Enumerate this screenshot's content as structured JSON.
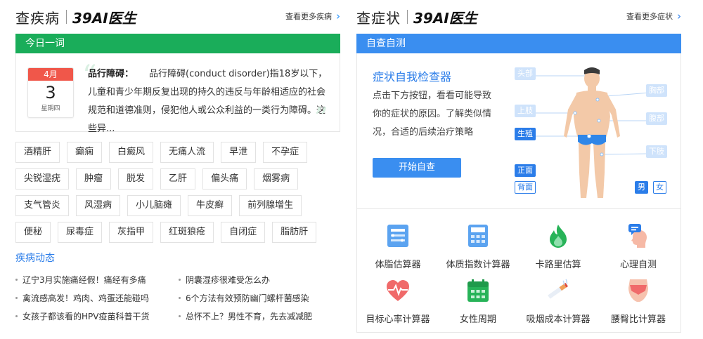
{
  "left": {
    "title": "查疾病",
    "brand": "39AI医生",
    "more": "查看更多疾病",
    "bar": "今日一词",
    "calendar": {
      "month": "4月",
      "day": "3",
      "weekday": "星期四"
    },
    "word": {
      "term": "品行障碍：",
      "text": "品行障碍(conduct disorder)指18岁以下，儿童和青少年期反复出现的持久的违反与年龄相适应的社会规范和道德准则，侵犯他人或公众利益的一类行为障碍。这些异..."
    },
    "tags": [
      [
        "酒精肝",
        "癫痫",
        "白癜风",
        "无痛人流",
        "早泄",
        "不孕症"
      ],
      [
        "尖锐湿疣",
        "肿瘤",
        "脱发",
        "乙肝",
        "偏头痛",
        "烟雾病"
      ],
      [
        "支气管炎",
        "风湿病",
        "小儿脑瘫",
        "牛皮癣",
        "前列腺增生"
      ],
      [
        "便秘",
        "尿毒症",
        "灰指甲",
        "红斑狼疮",
        "自闭症",
        "脂肪肝"
      ]
    ],
    "news_title": "疾病动态",
    "news": [
      [
        "辽宁3月实施痛经假！痛经有多痛",
        "阴囊湿疹很难受怎么办"
      ],
      [
        "禽流感高发！鸡肉、鸡蛋还能碰吗",
        "6个方法有效预防幽门螺杆菌感染"
      ],
      [
        "女孩子都该看的HPV疫苗科普干货",
        "总怀不上？男性不育，先去减减肥"
      ]
    ]
  },
  "right": {
    "title": "查症状",
    "brand": "39AI医生",
    "more": "查看更多症状",
    "bar": "自查自测",
    "checker": {
      "title": "症状自我检查器",
      "desc": "点击下方按钮，看看可能导致你的症状的原因。了解类似情况，合适的后续治疗策略",
      "button": "开始自查"
    },
    "body_tags": {
      "head": "头部",
      "upper_limb": "上肢",
      "genital": "生殖",
      "chest": "胸部",
      "abdomen": "腹部",
      "lower_limb": "下肢",
      "front": "正面",
      "back": "背面",
      "male": "男",
      "female": "女"
    },
    "tools": [
      {
        "label": "体脂估算器",
        "icon": "body-fat-icon"
      },
      {
        "label": "体质指数计算器",
        "icon": "bmi-calculator-icon"
      },
      {
        "label": "卡路里估算",
        "icon": "calorie-flame-icon"
      },
      {
        "label": "心理自测",
        "icon": "psychology-head-icon"
      },
      {
        "label": "目标心率计算器",
        "icon": "heart-rate-icon"
      },
      {
        "label": "女性周期",
        "icon": "calendar-cycle-icon"
      },
      {
        "label": "吸烟成本计算器",
        "icon": "cigarette-icon"
      },
      {
        "label": "腰臀比计算器",
        "icon": "waist-hip-icon"
      }
    ]
  },
  "colors": {
    "green": "#1aad5a",
    "blue": "#3a8ef0",
    "link": "#2b7de9",
    "red": "#f0574a"
  }
}
